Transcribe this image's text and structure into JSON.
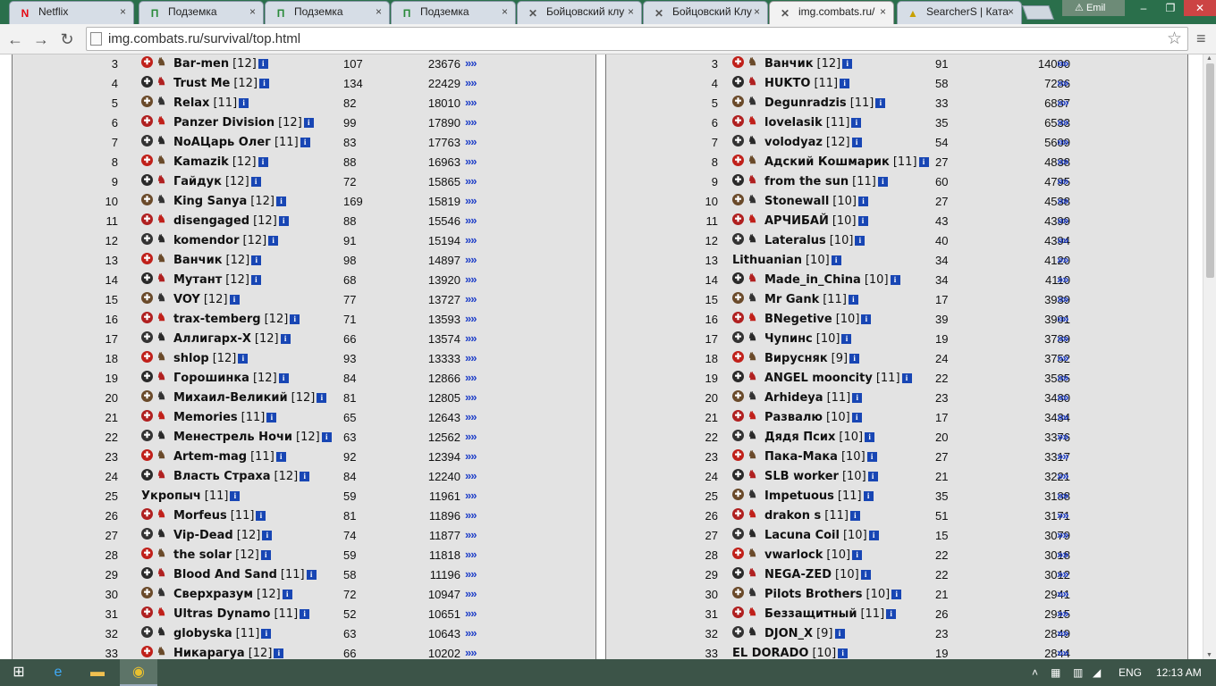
{
  "tabs": [
    {
      "title": "Netflix",
      "icon": "N",
      "color": "#e50914"
    },
    {
      "title": "Подземка",
      "icon": "П",
      "color": "#2a8a3a"
    },
    {
      "title": "Подземка",
      "icon": "П",
      "color": "#2a8a3a"
    },
    {
      "title": "Подземка",
      "icon": "П",
      "color": "#2a8a3a"
    },
    {
      "title": "Бойцовский клу",
      "icon": "✕",
      "color": "#555"
    },
    {
      "title": "Бойцовский Клу",
      "icon": "✕",
      "color": "#555"
    },
    {
      "title": "img.combats.ru/",
      "icon": "✕",
      "color": "#555"
    },
    {
      "title": "SearcherS | Ката",
      "icon": "▲",
      "color": "#c8a000"
    }
  ],
  "user": "Emil",
  "url": "img.combats.ru/survival/top.html",
  "close_glyph": "×",
  "left_rows": [
    {
      "rank": "3",
      "name": "Bar-men",
      "level": "[12]",
      "count": "107",
      "score": "23676"
    },
    {
      "rank": "4",
      "name": "Trust Me",
      "level": "[12]",
      "count": "134",
      "score": "22429"
    },
    {
      "rank": "5",
      "name": "Relax",
      "level": "[11]",
      "count": "82",
      "score": "18010"
    },
    {
      "rank": "6",
      "name": "Panzer Division",
      "level": "[12]",
      "count": "99",
      "score": "17890"
    },
    {
      "rank": "7",
      "name": "NoAЦарь Олег",
      "level": "[11]",
      "count": "83",
      "score": "17763"
    },
    {
      "rank": "8",
      "name": "Kamazik",
      "level": "[12]",
      "count": "88",
      "score": "16963"
    },
    {
      "rank": "9",
      "name": "Гайдук",
      "level": "[12]",
      "count": "72",
      "score": "15865"
    },
    {
      "rank": "10",
      "name": "King Sanya",
      "level": "[12]",
      "count": "169",
      "score": "15819"
    },
    {
      "rank": "11",
      "name": "disengaged",
      "level": "[12]",
      "count": "88",
      "score": "15546"
    },
    {
      "rank": "12",
      "name": "komendor",
      "level": "[12]",
      "count": "91",
      "score": "15194"
    },
    {
      "rank": "13",
      "name": "Ванчик",
      "level": "[12]",
      "count": "98",
      "score": "14897"
    },
    {
      "rank": "14",
      "name": "Мутант",
      "level": "[12]",
      "count": "68",
      "score": "13920"
    },
    {
      "rank": "15",
      "name": "VOY",
      "level": "[12]",
      "count": "77",
      "score": "13727"
    },
    {
      "rank": "16",
      "name": "trax-temberg",
      "level": "[12]",
      "count": "71",
      "score": "13593"
    },
    {
      "rank": "17",
      "name": "Аллигарх-X",
      "level": "[12]",
      "count": "66",
      "score": "13574"
    },
    {
      "rank": "18",
      "name": "shlop",
      "level": "[12]",
      "count": "93",
      "score": "13333"
    },
    {
      "rank": "19",
      "name": "Горошинка",
      "level": "[12]",
      "count": "84",
      "score": "12866"
    },
    {
      "rank": "20",
      "name": "Михаил-Великий",
      "level": "[12]",
      "count": "81",
      "score": "12805"
    },
    {
      "rank": "21",
      "name": "Memories",
      "level": "[11]",
      "count": "65",
      "score": "12643"
    },
    {
      "rank": "22",
      "name": "Менестрель Ночи",
      "level": "[12]",
      "count": "63",
      "score": "12562"
    },
    {
      "rank": "23",
      "name": "Artem-mag",
      "level": "[11]",
      "count": "92",
      "score": "12394"
    },
    {
      "rank": "24",
      "name": "Власть Страха",
      "level": "[12]",
      "count": "84",
      "score": "12240"
    },
    {
      "rank": "25",
      "name": "Укропыч",
      "level": "[11]",
      "count": "59",
      "score": "11961"
    },
    {
      "rank": "26",
      "name": "Morfeus",
      "level": "[11]",
      "count": "81",
      "score": "11896"
    },
    {
      "rank": "27",
      "name": "Vip-Dead",
      "level": "[12]",
      "count": "74",
      "score": "11877"
    },
    {
      "rank": "28",
      "name": "the solar",
      "level": "[12]",
      "count": "59",
      "score": "11818"
    },
    {
      "rank": "29",
      "name": "Blood And Sand",
      "level": "[11]",
      "count": "58",
      "score": "11196"
    },
    {
      "rank": "30",
      "name": "Сверхразум",
      "level": "[12]",
      "count": "72",
      "score": "10947"
    },
    {
      "rank": "31",
      "name": "Ultras Dynamo",
      "level": "[11]",
      "count": "52",
      "score": "10651"
    },
    {
      "rank": "32",
      "name": "globyska",
      "level": "[11]",
      "count": "63",
      "score": "10643"
    },
    {
      "rank": "33",
      "name": "Никарагуа",
      "level": "[12]",
      "count": "66",
      "score": "10202"
    }
  ],
  "right_rows": [
    {
      "rank": "3",
      "name": "Ванчик",
      "level": "[12]",
      "count": "91",
      "score": "14000"
    },
    {
      "rank": "4",
      "name": "HUKTO",
      "level": "[11]",
      "count": "58",
      "score": "7286"
    },
    {
      "rank": "5",
      "name": "Degunradzis",
      "level": "[11]",
      "count": "33",
      "score": "6887"
    },
    {
      "rank": "6",
      "name": "lovelasik",
      "level": "[11]",
      "count": "35",
      "score": "6533"
    },
    {
      "rank": "7",
      "name": "volodyaz",
      "level": "[12]",
      "count": "54",
      "score": "5609"
    },
    {
      "rank": "8",
      "name": "Адский Кошмарик",
      "level": "[11]",
      "count": "27",
      "score": "4838"
    },
    {
      "rank": "9",
      "name": "from the sun",
      "level": "[11]",
      "count": "60",
      "score": "4795"
    },
    {
      "rank": "10",
      "name": "Stonewall",
      "level": "[10]",
      "count": "27",
      "score": "4538"
    },
    {
      "rank": "11",
      "name": "АРЧИБАЙ",
      "level": "[10]",
      "count": "43",
      "score": "4399"
    },
    {
      "rank": "12",
      "name": "Lateralus",
      "level": "[10]",
      "count": "40",
      "score": "4394"
    },
    {
      "rank": "13",
      "name": "Lithuanian",
      "level": "[10]",
      "count": "34",
      "score": "4120"
    },
    {
      "rank": "14",
      "name": "Made_in_China",
      "level": "[10]",
      "count": "34",
      "score": "4110"
    },
    {
      "rank": "15",
      "name": "Mr Gank",
      "level": "[11]",
      "count": "17",
      "score": "3939"
    },
    {
      "rank": "16",
      "name": "BNegetive",
      "level": "[10]",
      "count": "39",
      "score": "3901"
    },
    {
      "rank": "17",
      "name": "Чупинс",
      "level": "[10]",
      "count": "19",
      "score": "3789"
    },
    {
      "rank": "18",
      "name": "Вирусняк",
      "level": "[9]",
      "count": "24",
      "score": "3752"
    },
    {
      "rank": "19",
      "name": "ANGEL mooncity",
      "level": "[11]",
      "count": "22",
      "score": "3585"
    },
    {
      "rank": "20",
      "name": "Arhideya",
      "level": "[11]",
      "count": "23",
      "score": "3480"
    },
    {
      "rank": "21",
      "name": "Развалю",
      "level": "[10]",
      "count": "17",
      "score": "3434"
    },
    {
      "rank": "22",
      "name": "Дядя Псих",
      "level": "[10]",
      "count": "20",
      "score": "3376"
    },
    {
      "rank": "23",
      "name": "Пака-Мака",
      "level": "[10]",
      "count": "27",
      "score": "3317"
    },
    {
      "rank": "24",
      "name": "SLB worker",
      "level": "[10]",
      "count": "21",
      "score": "3221"
    },
    {
      "rank": "25",
      "name": "Impetuous",
      "level": "[11]",
      "count": "35",
      "score": "3188"
    },
    {
      "rank": "26",
      "name": "drakon s",
      "level": "[11]",
      "count": "51",
      "score": "3171"
    },
    {
      "rank": "27",
      "name": "Lacuna Coil",
      "level": "[10]",
      "count": "15",
      "score": "3079"
    },
    {
      "rank": "28",
      "name": "vwarlock",
      "level": "[10]",
      "count": "22",
      "score": "3018"
    },
    {
      "rank": "29",
      "name": "NEGA-ZED",
      "level": "[10]",
      "count": "22",
      "score": "3012"
    },
    {
      "rank": "30",
      "name": "Pilots Brothers",
      "level": "[10]",
      "count": "21",
      "score": "2941"
    },
    {
      "rank": "31",
      "name": "Беззащитный",
      "level": "[11]",
      "count": "26",
      "score": "2915"
    },
    {
      "rank": "32",
      "name": "DJON_X",
      "level": "[9]",
      "count": "23",
      "score": "2849"
    },
    {
      "rank": "33",
      "name": "EL DORADO",
      "level": "[10]",
      "count": "19",
      "score": "2844"
    }
  ],
  "row_link": "»»",
  "info_glyph": "i",
  "tray": {
    "lang": "ENG",
    "time": "12:13 AM"
  }
}
